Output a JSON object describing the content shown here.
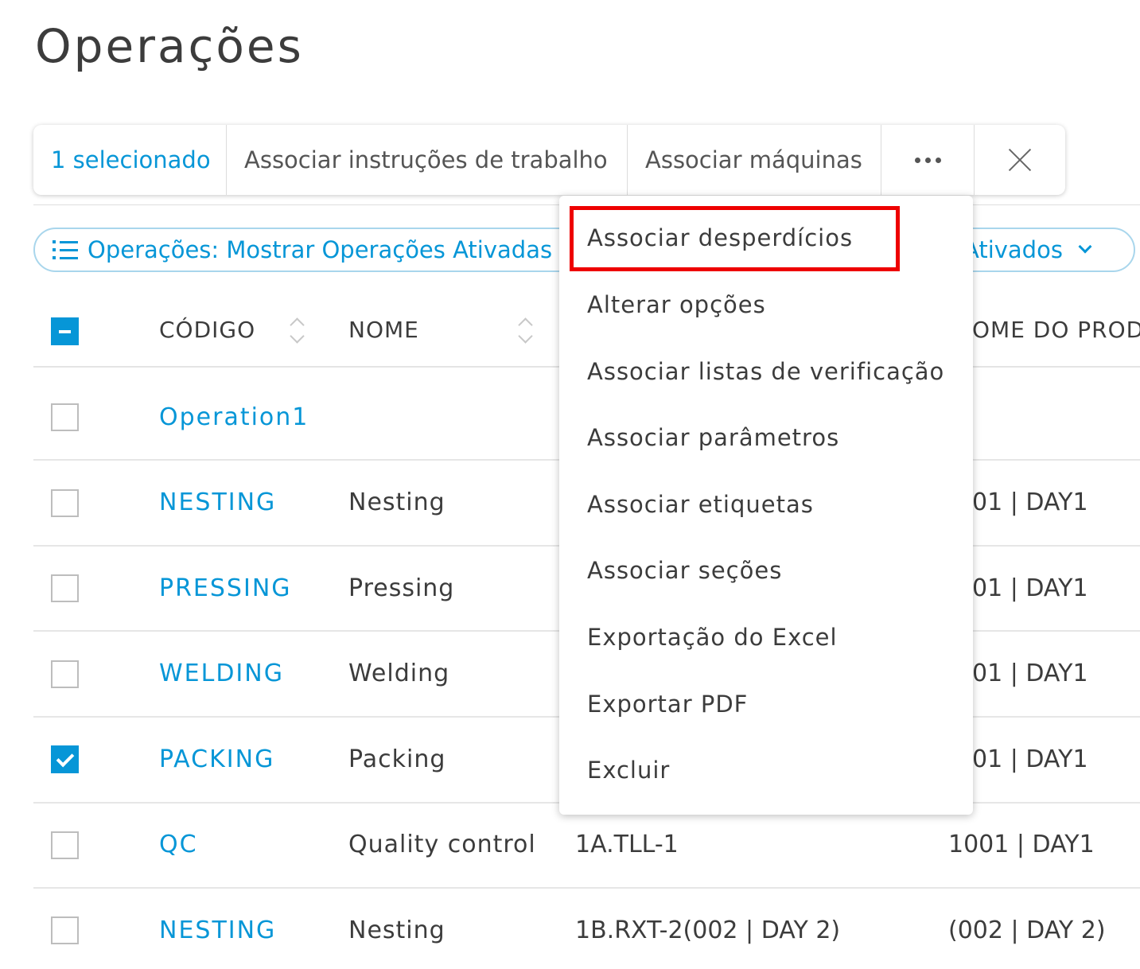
{
  "page": {
    "title": "Operações"
  },
  "toolbar": {
    "selected_count": "1 selecionado",
    "assign_instructions": "Associar instruções de trabalho",
    "assign_machines": "Associar máquinas"
  },
  "filters": {
    "operations_filter": "Operações: Mostrar Operações Ativadas",
    "right_filter_visible": "; Ativados"
  },
  "table": {
    "headers": {
      "code": "CÓDIGO",
      "name": "NOME",
      "product_name_partial": "OME DO PRODU"
    },
    "rows": [
      {
        "code": "Operation1",
        "name": "",
        "col3": "",
        "col4": "",
        "checked": false
      },
      {
        "code": "NESTING",
        "name": "Nesting",
        "col3": "",
        "col4": "01 | DAY1",
        "checked": false
      },
      {
        "code": "PRESSING",
        "name": "Pressing",
        "col3": "",
        "col4": "01 | DAY1",
        "checked": false
      },
      {
        "code": "WELDING",
        "name": "Welding",
        "col3": "",
        "col4": "01 | DAY1",
        "checked": false
      },
      {
        "code": "PACKING",
        "name": "Packing",
        "col3": "",
        "col4": "01 | DAY1",
        "checked": true
      },
      {
        "code": "QC",
        "name": "Quality control",
        "col3": "1A.TLL-1",
        "col4": "1001 | DAY1",
        "checked": false
      },
      {
        "code": "NESTING",
        "name": "Nesting",
        "col3": "1B.RXT-2(002 | DAY 2)",
        "col4": "(002 | DAY 2)",
        "checked": false
      }
    ]
  },
  "menu": {
    "items": [
      "Associar desperdícios",
      "Alterar opções",
      "Associar listas de verificação",
      "Associar parâmetros",
      "Associar etiquetas",
      "Associar seções",
      "Exportação do Excel",
      "Exportar PDF",
      "Excluir"
    ],
    "highlighted_index": 0
  },
  "colors": {
    "accent": "#0696d7",
    "highlight": "#ee0000"
  }
}
